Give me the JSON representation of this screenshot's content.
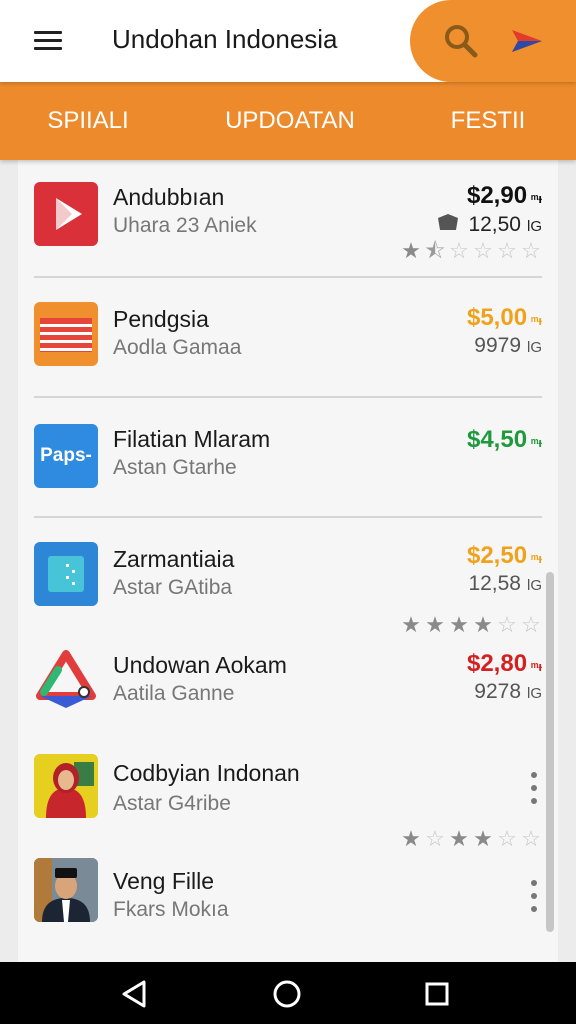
{
  "appbar": {
    "title": "Undohan Indonesia",
    "menu_icon": "menu-icon",
    "search_icon": "search-icon",
    "send_icon": "send-icon",
    "accent_color": "#ef8f2e"
  },
  "tabs": [
    {
      "label": "SPIIALI"
    },
    {
      "label": "UPDOATAN"
    },
    {
      "label": "FESTII"
    }
  ],
  "apps": [
    {
      "name": "Andubbıan",
      "subtitle": "Uhara 23 Aniek",
      "price": "$2,90",
      "price_unit": "ᵐᵻ",
      "size": "12,50",
      "size_unit": "lG",
      "rating": 1.5,
      "price_color": "#111111"
    },
    {
      "name": "Pendgsia",
      "subtitle": "Aodla Gamaa",
      "price": "$5,00",
      "price_unit": "ᵐᵻ",
      "size": "9979",
      "size_unit": "lG",
      "price_color": "#f0a21c"
    },
    {
      "name": "Filatian Mlaram",
      "subtitle": "Astan Gtarhe",
      "price": "$4,50",
      "price_unit": "ᵐᵻ",
      "price_color": "#1e9a3c"
    },
    {
      "name": "Zarmantiaia",
      "subtitle": "Astar GAtiba",
      "price": "$2,50",
      "price_unit": "ᵐᵻ",
      "size": "12,58",
      "size_unit": "lG",
      "rating": 4,
      "price_color": "#f0a21c"
    },
    {
      "name": "Undowan Aokam",
      "subtitle": "Aatila Ganne",
      "price": "$2,80",
      "price_unit": "ᵐᵻ",
      "size": "9278",
      "size_unit": "lG",
      "price_color": "#d32121"
    },
    {
      "name": "Codbyian Indonan",
      "subtitle": "Astar G4ribe",
      "rating": 3
    },
    {
      "name": "Veng Fille",
      "subtitle": "Fkars Mokıa"
    }
  ],
  "app_icons": [
    "play-store-icon",
    "flag-icon",
    "paps-icon",
    "folder-app-icon",
    "triangle-logo-icon",
    "woman-avatar-icon",
    "man-avatar-icon"
  ],
  "icon_texts": {
    "paps": "Paps-"
  },
  "navbar": {
    "back_icon": "back-icon",
    "home_icon": "home-icon",
    "recents_icon": "recents-icon"
  }
}
